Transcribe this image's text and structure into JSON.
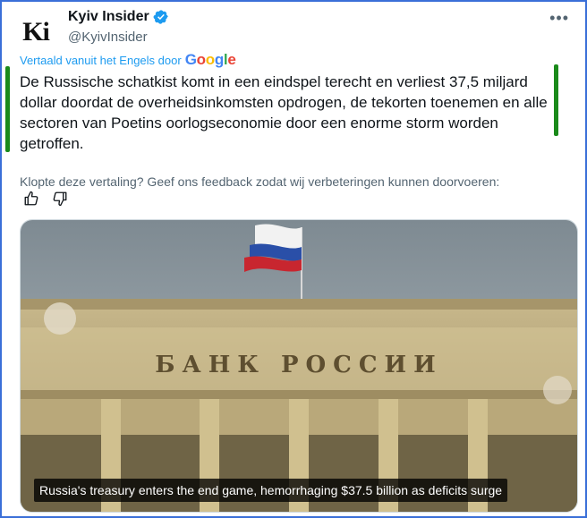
{
  "author": {
    "display_name": "Kyiv Insider",
    "handle": "@KyivInsider",
    "avatar_text": "Ki",
    "verified": true
  },
  "translation": {
    "label": "Vertaald vanuit het Engels door",
    "provider": "Google"
  },
  "tweet": {
    "text": "De Russische schatkist komt in een eindspel terecht en verliest 37,5 miljard dollar doordat de overheidsinkomsten opdrogen, de tekorten toenemen en alle sectoren van Poetins oorlogseconomie door een enorme storm worden getroffen."
  },
  "feedback": {
    "prompt": "Klopte deze vertaling? Geef ons feedback zodat wij verbeteringen kunnen doorvoeren:",
    "icons": [
      "thumbs-up-icon",
      "thumbs-down-icon"
    ]
  },
  "media": {
    "building_inscription": "БАНК РОССИИ",
    "caption": "Russia's treasury enters the end game, hemorrhaging $37.5 billion as deficits surge"
  },
  "colors": {
    "frame_border": "#3a6fd8",
    "verified_blue": "#1d9bf0",
    "annotation_green": "#1a8a1a",
    "text_primary": "#0f1419",
    "text_secondary": "#536471"
  }
}
